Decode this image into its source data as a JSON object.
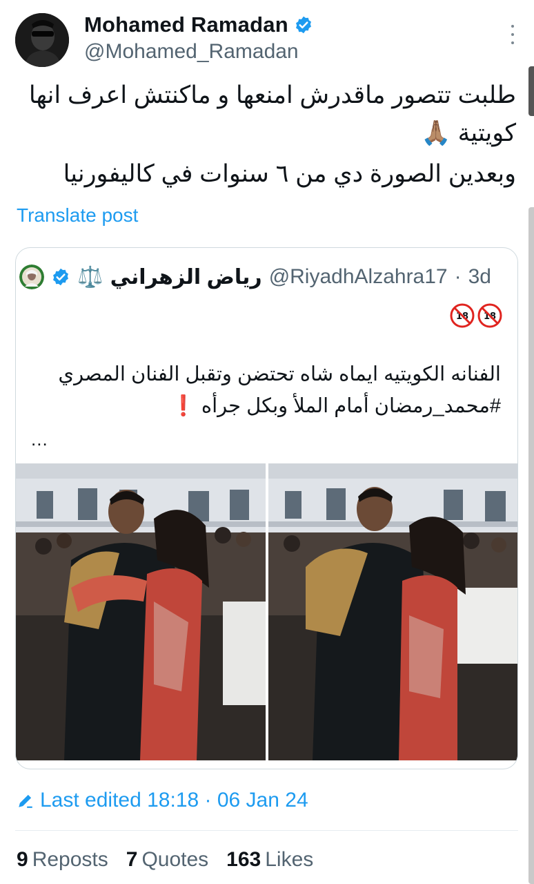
{
  "author": {
    "display_name": "Mohamed Ramadan",
    "handle": "@Mohamed_Ramadan",
    "verified": true
  },
  "icons": {
    "verified": "verified-badge-icon",
    "more": "more-vertical-icon",
    "edit": "pencil-icon",
    "age_restricted": "no-under-18-icon"
  },
  "tweet": {
    "text_lines": [
      "طلبت تتصور ماقدرش امنعها و ماكنتش اعرف انها",
      "كويتية 🙏🏽",
      "وبعدين الصورة دي من ٦ سنوات في كاليفورنيا"
    ],
    "translate_label": "Translate post"
  },
  "quoted": {
    "name": "رياض الزهراني",
    "name_emoji": "⚖️",
    "handle": "@RiyadhAlzahra17",
    "time": "3d",
    "separator": "·",
    "emoji_line": "🔞🔞",
    "text_line1": "الفنانه الكويتيه ايماه شاه تحتضن وتقبل الفنان المصري",
    "text_line2": "#محمد_رمضان أمام الملأ وبكل جرأه",
    "text_exclaim": "❗",
    "ellipsis": "..."
  },
  "edited": {
    "label": "Last edited 18:18 · 06 Jan 24"
  },
  "stats": {
    "reposts_count": "9",
    "reposts_label": "Reposts",
    "quotes_count": "7",
    "quotes_label": "Quotes",
    "likes_count": "163",
    "likes_label": "Likes"
  },
  "colors": {
    "accent": "#1d9bf0",
    "text_primary": "#0f1419",
    "text_secondary": "#536471",
    "border": "#cfd9de",
    "alert": "#e0241f"
  }
}
